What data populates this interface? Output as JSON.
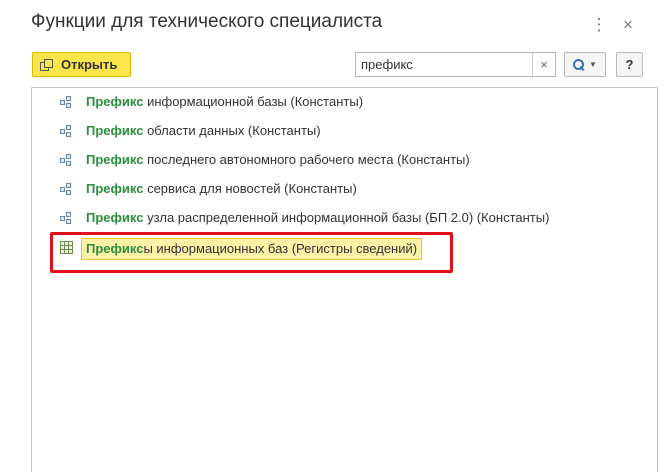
{
  "window": {
    "title": "Функции для технического специалиста",
    "more_icon": "⋮",
    "close_icon": "×"
  },
  "toolbar": {
    "open_label": "Открыть"
  },
  "search": {
    "value": "префикс",
    "clear_icon": "×"
  },
  "help": {
    "label": "?"
  },
  "list": {
    "items": [
      {
        "highlight": "Префикс",
        "rest": " информационной базы (Константы)",
        "icon": "constant-icon"
      },
      {
        "highlight": "Префикс",
        "rest": " области данных (Константы)",
        "icon": "constant-icon"
      },
      {
        "highlight": "Префикс",
        "rest": " последнего автономного рабочего места (Константы)",
        "icon": "constant-icon"
      },
      {
        "highlight": "Префикс",
        "rest": " сервиса для новостей (Константы)",
        "icon": "constant-icon"
      },
      {
        "highlight": "Префикс",
        "rest": " узла распределенной информационной базы (БП 2.0) (Константы)",
        "icon": "constant-icon"
      },
      {
        "highlight": "Префикс",
        "rest": "ы информационных баз (Регистры сведений)",
        "icon": "register-icon",
        "selected": true
      }
    ]
  },
  "colors": {
    "accent_button": "#fbe54a",
    "match_highlight": "#2a8f3d",
    "selection_bg": "#fdf1a8",
    "annotation_box": "#e0101c"
  }
}
